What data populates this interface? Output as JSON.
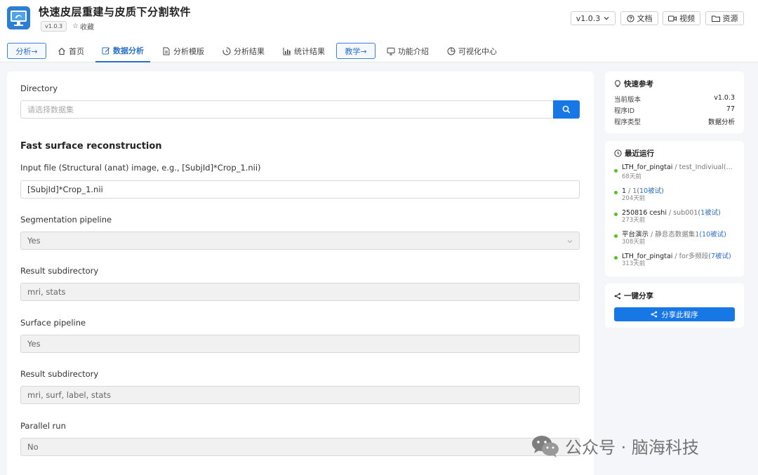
{
  "app": {
    "title": "快速皮层重建与皮质下分割软件",
    "version_badge": "v1.0.3",
    "favorite_label": "收藏",
    "favorite_icon": "☆"
  },
  "header_buttons": {
    "version": "v1.0.3",
    "docs": "文档",
    "video": "视频",
    "resources": "资源"
  },
  "nav": {
    "analysis_btn": "分析→",
    "teaching_btn": "教学→",
    "items": {
      "home": "首页",
      "data_analysis": "数据分析",
      "templates": "分析模版",
      "results": "分析结果",
      "stats": "统计结果",
      "features": "功能介绍",
      "viz": "可视化中心"
    }
  },
  "form": {
    "directory_label": "Directory",
    "directory_placeholder": "请选择数据集",
    "section_title": "Fast surface reconstruction",
    "input_label": "Input file (Structural (anat) image, e.g., [SubjId]*Crop_1.nii)",
    "input_value": "[SubjId]*Crop_1.nii",
    "seg_label": "Segmentation pipeline",
    "seg_value": "Yes",
    "result1_label": "Result subdirectory",
    "result1_value": "mri, stats",
    "surface_label": "Surface pipeline",
    "surface_value": "Yes",
    "result2_label": "Result subdirectory",
    "result2_value": "mri, surf, label, stats",
    "parallel_label": "Parallel run",
    "parallel_value": "No"
  },
  "quick_ref": {
    "title": "快速参考",
    "rows": [
      {
        "k": "当前版本",
        "v": "v1.0.3"
      },
      {
        "k": "程序ID",
        "v": "77"
      },
      {
        "k": "程序类型",
        "v": "数据分析"
      }
    ]
  },
  "recent": {
    "title": "最近运行",
    "runs": [
      {
        "name": "LTH_for_pingtai",
        "sep": " / ",
        "sub": "test_Indiviual(...",
        "link": "",
        "time": "68天前"
      },
      {
        "name": "1",
        "sep": " / ",
        "sub": "1",
        "link": "(10被试)",
        "time": "204天前"
      },
      {
        "name": "250816 ceshi",
        "sep": " / ",
        "sub": "sub001",
        "link": "(1被试)",
        "time": "273天前"
      },
      {
        "name": "平台演示",
        "sep": " / ",
        "sub": "静息态数据集1",
        "link": "(10被试)",
        "time": "308天前"
      },
      {
        "name": "LTH_for_pingtai",
        "sep": " / ",
        "sub": "for多频段",
        "link": "(7被试)",
        "time": "313天前"
      }
    ]
  },
  "share": {
    "title": "一键分享",
    "button": "分享此程序"
  },
  "watermark": {
    "text": "公众号 · 脑海科技"
  },
  "colors": {
    "primary": "#1677e5",
    "accent_text": "#2b6fc7",
    "status_dot": "#52c41a"
  }
}
